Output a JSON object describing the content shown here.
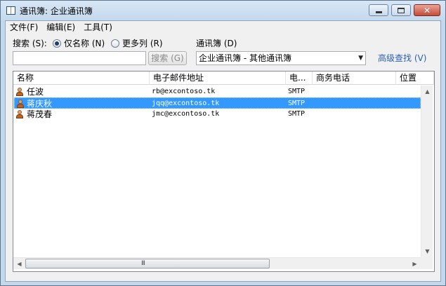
{
  "window": {
    "title": "通讯簿: 企业通讯簿",
    "controls": {
      "minimize": "minimize",
      "maximize": "maximize",
      "close": "✕"
    }
  },
  "menu": [
    {
      "label": "文件(F)"
    },
    {
      "label": "编辑(E)"
    },
    {
      "label": "工具(T)"
    }
  ],
  "search": {
    "label": "搜索 (S):",
    "option_name_only": "仅名称 (N)",
    "option_more_columns": "更多列 (R)",
    "selected_option": "仅名称 (N)",
    "input_value": "",
    "button_label": "搜索 (G)"
  },
  "address_book": {
    "label": "通讯簿 (D)",
    "selected": "企业通讯簿 - 其他通讯簿",
    "advanced_link": "高级查找 (V)"
  },
  "list": {
    "columns": [
      "名称",
      "电子邮件地址",
      "电...",
      "商务电话",
      "位置"
    ],
    "rows": [
      {
        "name": "任波",
        "email": "rb@excontoso.tk",
        "type": "SMTP",
        "phone": "",
        "location": "",
        "selected": false
      },
      {
        "name": "蒋庆秋",
        "email": "jqq@excontoso.tk",
        "type": "SMTP",
        "phone": "",
        "location": "",
        "selected": true
      },
      {
        "name": "蒋茂春",
        "email": "jmc@excontoso.tk",
        "type": "SMTP",
        "phone": "",
        "location": "",
        "selected": false
      }
    ]
  },
  "scrollbars": {
    "up": "▲",
    "down": "▼",
    "left": "◀",
    "right": "▶",
    "grip": "III"
  },
  "colors": {
    "selection": "#3399ff",
    "link": "#2b5fb4",
    "close_button": "#c44a37"
  },
  "icons": {
    "window": "address-book-icon",
    "contact": "person-icon"
  }
}
